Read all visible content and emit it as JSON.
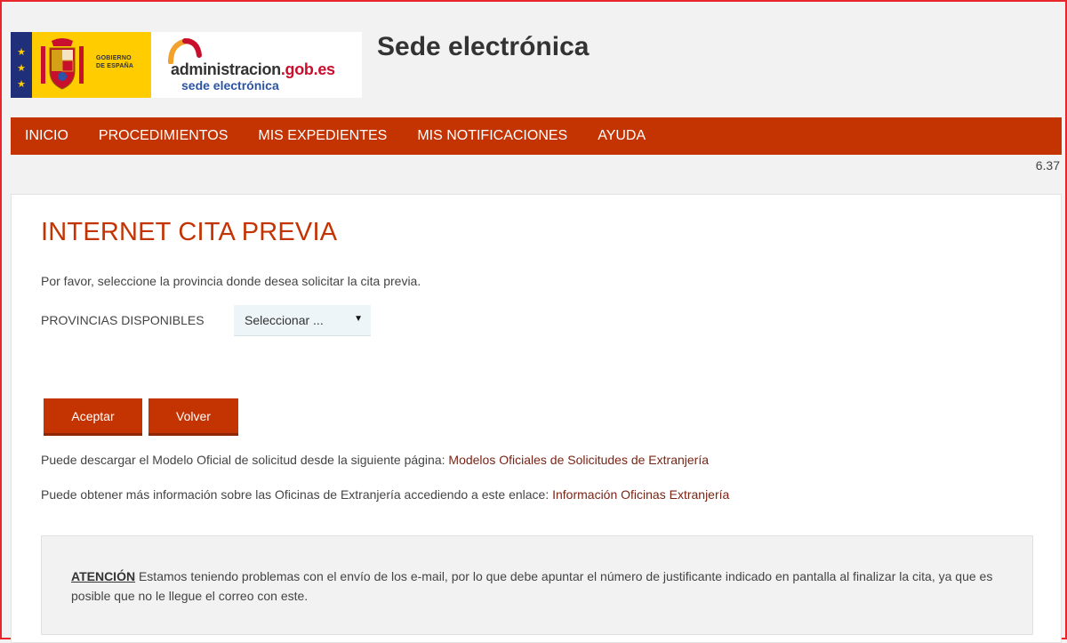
{
  "header": {
    "gobierno_line1": "GOBIERNO",
    "gobierno_line2": "DE ESPAÑA",
    "admin_name": "administracion",
    "admin_domain": ".gob.es",
    "admin_sub": "sede electrónica",
    "site_title": "Sede electrónica"
  },
  "nav": {
    "items": [
      {
        "label": "INICIO"
      },
      {
        "label": "PROCEDIMIENTOS"
      },
      {
        "label": "MIS EXPEDIENTES"
      },
      {
        "label": "MIS NOTIFICACIONES"
      },
      {
        "label": "AYUDA"
      }
    ],
    "version": "6.37"
  },
  "main": {
    "heading": "INTERNET CITA PREVIA",
    "intro": "Por favor, seleccione la provincia donde desea solicitar la cita previa.",
    "province_label": "PROVINCIAS DISPONIBLES",
    "province_select_value": "Seleccionar ...",
    "accept_label": "Aceptar",
    "back_label": "Volver",
    "info1_text": "Puede descargar el Modelo Oficial de solicitud desde la siguiente página: ",
    "info1_link": "Modelos Oficiales de Solicitudes de Extranjería",
    "info2_text": "Puede obtener más información sobre las Oficinas de Extranjería accediendo a este enlace: ",
    "info2_link": "Información Oficinas Extranjería",
    "notice_label": "ATENCIÓN",
    "notice_text": " Estamos teniendo problemas con el envío de los e-mail, por lo que debe apuntar el número de justificante indicado en pantalla al finalizar la cita, ya que es posible que no le llegue el correo con este."
  },
  "colors": {
    "accent": "#c43302",
    "link": "#7a2416",
    "border": "#e8262c"
  }
}
